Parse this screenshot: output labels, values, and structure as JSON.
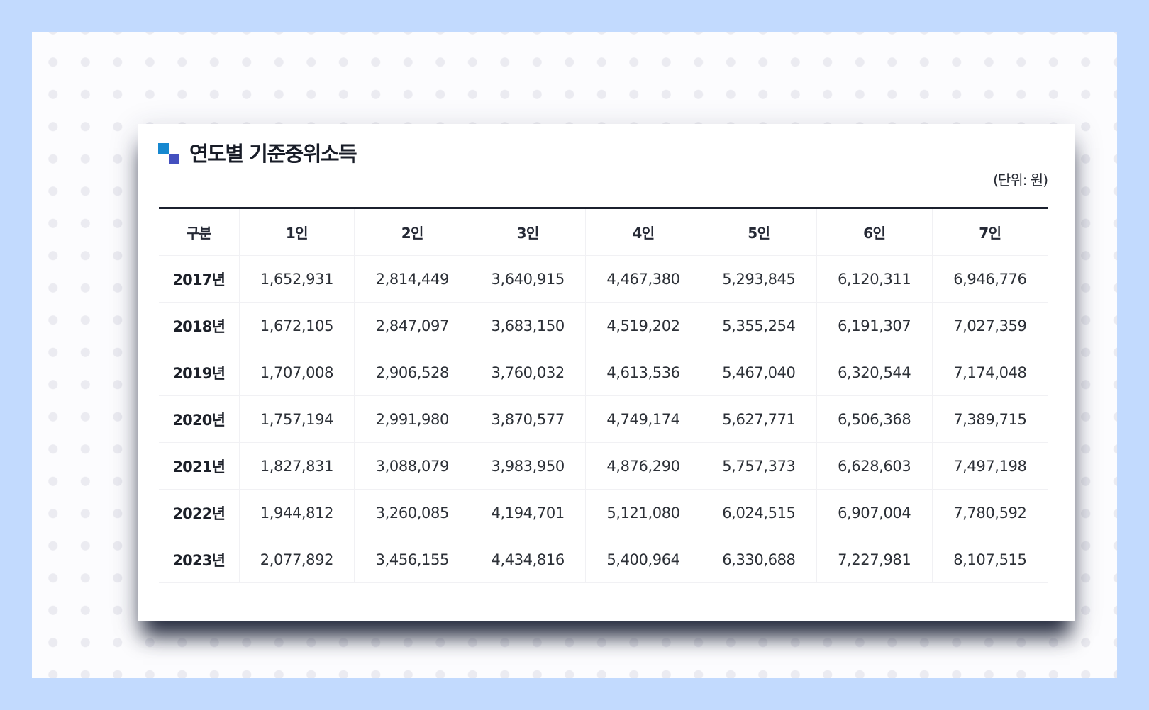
{
  "title": "연도별 기준중위소득",
  "unit": "(단위: 원)",
  "table": {
    "headers": [
      "구분",
      "1인",
      "2인",
      "3인",
      "4인",
      "5인",
      "6인",
      "7인"
    ],
    "rows": [
      [
        "2017년",
        "1,652,931",
        "2,814,449",
        "3,640,915",
        "4,467,380",
        "5,293,845",
        "6,120,311",
        "6,946,776"
      ],
      [
        "2018년",
        "1,672,105",
        "2,847,097",
        "3,683,150",
        "4,519,202",
        "5,355,254",
        "6,191,307",
        "7,027,359"
      ],
      [
        "2019년",
        "1,707,008",
        "2,906,528",
        "3,760,032",
        "4,613,536",
        "5,467,040",
        "6,320,544",
        "7,174,048"
      ],
      [
        "2020년",
        "1,757,194",
        "2,991,980",
        "3,870,577",
        "4,749,174",
        "5,627,771",
        "6,506,368",
        "7,389,715"
      ],
      [
        "2021년",
        "1,827,831",
        "3,088,079",
        "3,983,950",
        "4,876,290",
        "5,757,373",
        "6,628,603",
        "7,497,198"
      ],
      [
        "2022년",
        "1,944,812",
        "3,260,085",
        "4,194,701",
        "5,121,080",
        "6,024,515",
        "6,907,004",
        "7,780,592"
      ],
      [
        "2023년",
        "2,077,892",
        "3,456,155",
        "4,434,816",
        "5,400,964",
        "6,330,688",
        "7,227,981",
        "8,107,515"
      ]
    ]
  },
  "colors": {
    "page_background": "#c2dafe",
    "canvas_background": "#fcfcfe",
    "canvas_dots": "#ebebf1",
    "card_background": "#ffffff",
    "title_mark_primary": "#1688d0",
    "title_mark_secondary": "#4450bf",
    "table_top_rule": "#1b202e",
    "text_dark": "#181c27"
  },
  "icons": {
    "title_mark": "two-square-bullet-icon"
  }
}
